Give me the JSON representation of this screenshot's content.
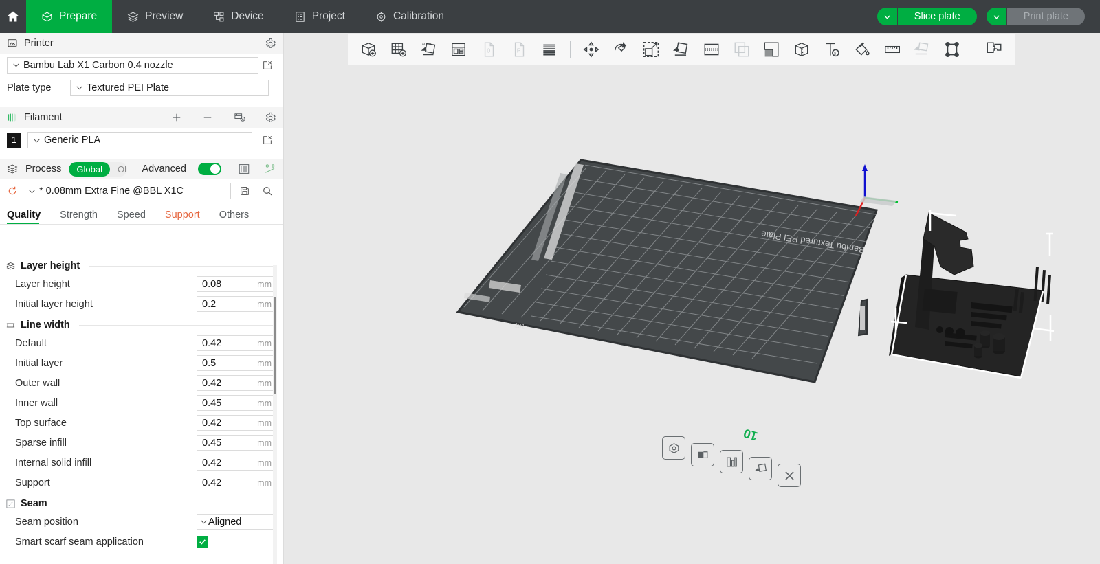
{
  "topbar": {
    "home_icon": "home-icon",
    "tabs": [
      {
        "label": "Prepare",
        "icon": "cube-outline-icon",
        "active": true
      },
      {
        "label": "Preview",
        "icon": "layers-icon",
        "active": false
      },
      {
        "label": "Device",
        "icon": "device-node-icon",
        "active": false
      },
      {
        "label": "Project",
        "icon": "list-document-icon",
        "active": false
      },
      {
        "label": "Calibration",
        "icon": "target-gear-icon",
        "active": false
      }
    ],
    "slice_plate_label": "Slice plate",
    "print_plate_label": "Print plate",
    "slice_caret_icon": "chevron-down-icon",
    "print_caret_icon": "chevron-down-icon",
    "colors": {
      "bar_bg": "#3b3f42",
      "accent_green": "#00ae42",
      "disabled_gray": "#6f7478"
    }
  },
  "sidebar": {
    "printer": {
      "section_title": "Printer",
      "section_icon": "printer-icon",
      "settings_icon": "gear-icon",
      "model_value": "Bambu Lab X1 Carbon 0.4 nozzle",
      "model_edit_icon": "edit-icon",
      "plate_type_label": "Plate type",
      "plate_type_value": "Textured PEI Plate"
    },
    "filament": {
      "section_title": "Filament",
      "section_icon": "filament-spool-icon",
      "add_icon": "plus-icon",
      "remove_icon": "minus-icon",
      "ams_icon": "ams-sync-icon",
      "settings_icon": "gear-icon",
      "index": "1",
      "value": "Generic PLA",
      "edit_icon": "edit-icon"
    },
    "process": {
      "section_title": "Process",
      "section_icon": "process-stack-icon",
      "scope_options": [
        "Global",
        "Objects"
      ],
      "scope_selected": "Global",
      "advanced_label": "Advanced",
      "advanced_on": true,
      "compare_icon": "list-settings-icon",
      "modifier_icon": "parameter-diff-icon",
      "reset_icon": "reset-arrow-icon",
      "preset_value": "* 0.08mm Extra Fine @BBL X1C",
      "save_icon": "save-icon",
      "search_icon": "search-icon",
      "tabs": [
        {
          "label": "Quality",
          "active": true,
          "warn": false
        },
        {
          "label": "Strength",
          "active": false,
          "warn": false
        },
        {
          "label": "Speed",
          "active": false,
          "warn": false
        },
        {
          "label": "Support",
          "active": false,
          "warn": true
        },
        {
          "label": "Others",
          "active": false,
          "warn": false
        }
      ]
    },
    "groups": [
      {
        "title": "Layer height",
        "icon": "layer-height-icon",
        "rows": [
          {
            "label": "Layer height",
            "value": "0.08",
            "unit": "mm",
            "type": "text"
          },
          {
            "label": "Initial layer height",
            "value": "0.2",
            "unit": "mm",
            "type": "text"
          }
        ]
      },
      {
        "title": "Line width",
        "icon": "line-width-icon",
        "rows": [
          {
            "label": "Default",
            "value": "0.42",
            "unit": "mm",
            "type": "text"
          },
          {
            "label": "Initial layer",
            "value": "0.5",
            "unit": "mm",
            "type": "text"
          },
          {
            "label": "Outer wall",
            "value": "0.42",
            "unit": "mm",
            "type": "text"
          },
          {
            "label": "Inner wall",
            "value": "0.45",
            "unit": "mm",
            "type": "text"
          },
          {
            "label": "Top surface",
            "value": "0.42",
            "unit": "mm",
            "type": "text"
          },
          {
            "label": "Sparse infill",
            "value": "0.45",
            "unit": "mm",
            "type": "text"
          },
          {
            "label": "Internal solid infill",
            "value": "0.42",
            "unit": "mm",
            "type": "text"
          },
          {
            "label": "Support",
            "value": "0.42",
            "unit": "mm",
            "type": "text"
          }
        ]
      },
      {
        "title": "Seam",
        "icon": "seam-icon",
        "rows": [
          {
            "label": "Seam position",
            "value": "Aligned",
            "unit": "",
            "type": "select"
          },
          {
            "label": "Smart scarf seam application",
            "value": "",
            "unit": "",
            "type": "checkbox",
            "checked": true
          }
        ]
      }
    ]
  },
  "viewport": {
    "toolbar": [
      {
        "icon": "add-object-icon",
        "dim": false
      },
      {
        "icon": "add-plate-icon",
        "dim": false
      },
      {
        "icon": "auto-arrange-icon",
        "dim": false
      },
      {
        "icon": "layout-split-icon",
        "dim": false
      },
      {
        "icon": "copy-object-icon",
        "dim": true
      },
      {
        "icon": "paste-object-icon",
        "dim": true
      },
      {
        "icon": "variable-layer-height-icon",
        "dim": false
      },
      {
        "sep": true
      },
      {
        "icon": "move-icon",
        "dim": false
      },
      {
        "icon": "rotate-icon",
        "dim": false
      },
      {
        "icon": "scale-icon",
        "dim": false
      },
      {
        "icon": "place-on-face-icon",
        "dim": false
      },
      {
        "icon": "cut-icon",
        "dim": false
      },
      {
        "icon": "mesh-boolean-icon",
        "dim": true
      },
      {
        "icon": "support-paint-icon",
        "dim": false
      },
      {
        "icon": "seam-paint-icon",
        "dim": false
      },
      {
        "icon": "text-emboss-icon",
        "dim": false
      },
      {
        "icon": "color-paint-icon",
        "dim": false
      },
      {
        "icon": "measure-icon",
        "dim": false
      },
      {
        "icon": "assembly-icon",
        "dim": true
      },
      {
        "icon": "simplify-mesh-icon",
        "dim": false
      },
      {
        "sep": true
      },
      {
        "icon": "puzzle-plugin-icon",
        "dim": false
      }
    ],
    "plate": {
      "brand_text": "Bambu Textured PEI Plate",
      "origin_axis": {
        "x_color": "#e02020",
        "y_color": "#00c030",
        "z_color": "#1010d0"
      },
      "dimension_label_front": "10",
      "dimension_label_right": "10",
      "plate_color": "#44484a",
      "grid_color": "#8e9294",
      "model_color": "#1d1d1d",
      "selection_outline_color": "#ffffff"
    },
    "plate_actions": [
      {
        "icon": "plate-settings-icon"
      },
      {
        "icon": "plate-name-icon"
      },
      {
        "icon": "plate-arrange-icon"
      },
      {
        "icon": "plate-orient-icon"
      },
      {
        "icon": "plate-delete-icon"
      }
    ],
    "background_color": "#e8e8e8"
  }
}
